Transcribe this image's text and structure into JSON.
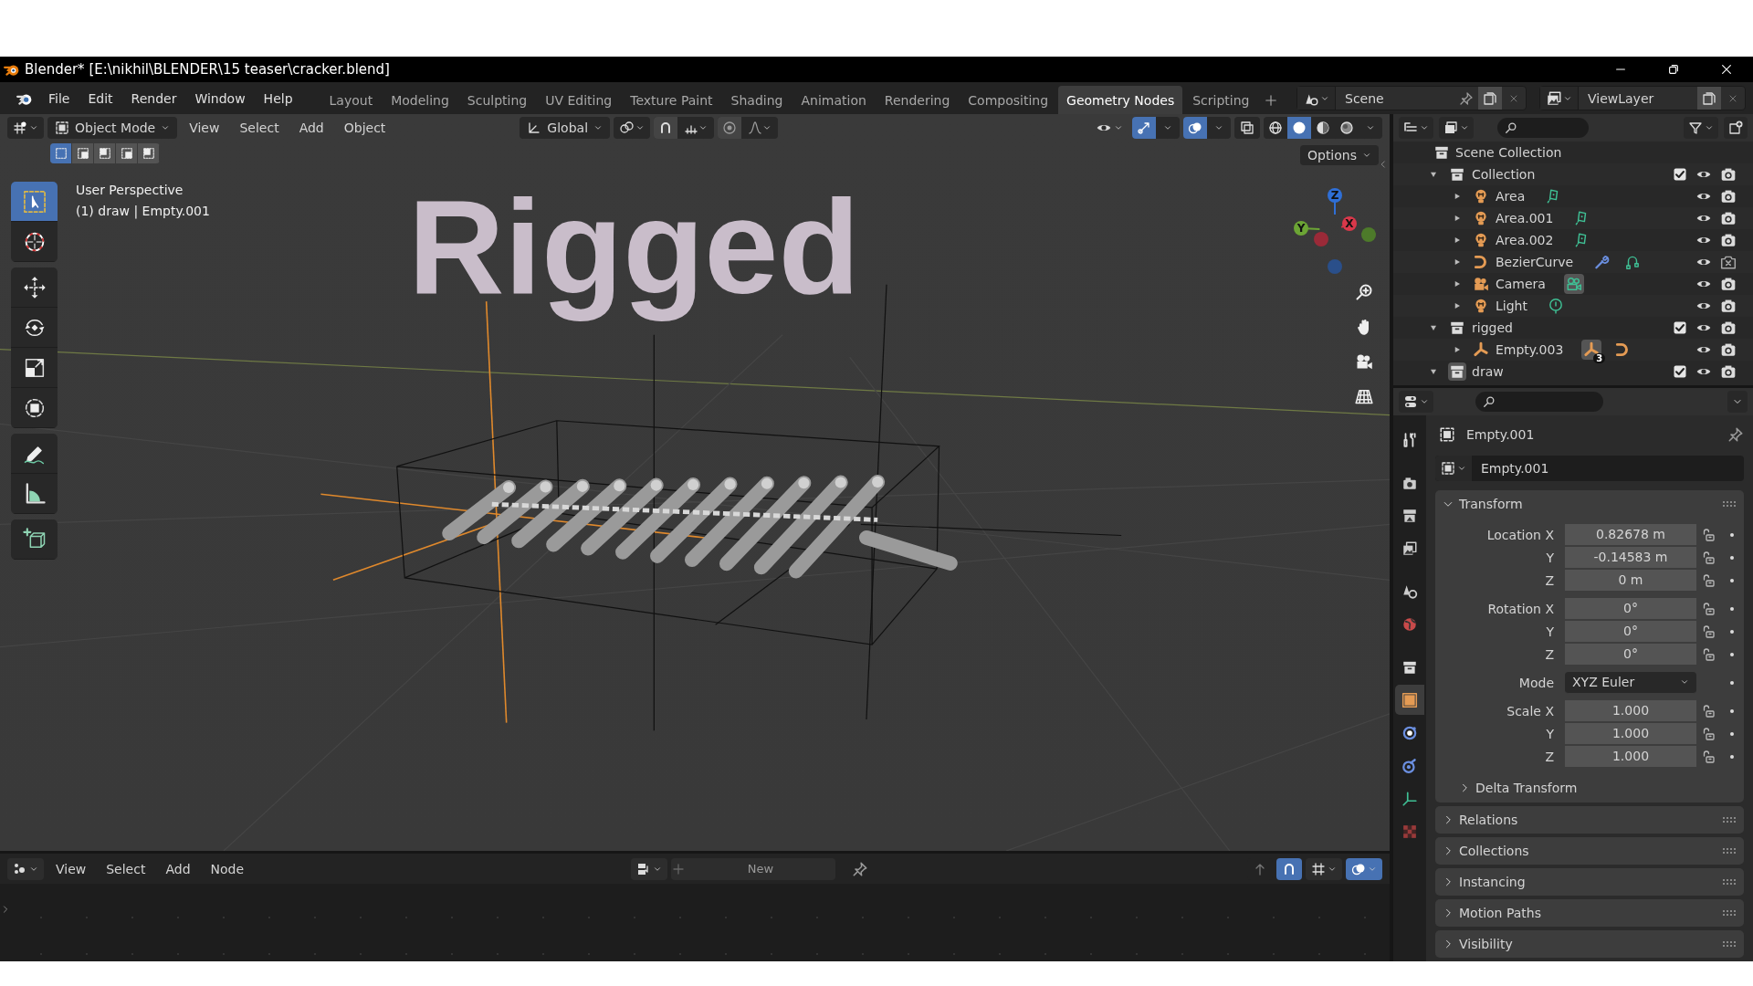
{
  "window": {
    "title": "Blender* [E:\\nikhil\\BLENDER\\15 teaser\\cracker.blend]"
  },
  "menu": [
    "File",
    "Edit",
    "Render",
    "Window",
    "Help"
  ],
  "workspaces": [
    {
      "label": "Layout",
      "selected": false
    },
    {
      "label": "Modeling",
      "selected": false
    },
    {
      "label": "Sculpting",
      "selected": false
    },
    {
      "label": "UV Editing",
      "selected": false
    },
    {
      "label": "Texture Paint",
      "selected": false
    },
    {
      "label": "Shading",
      "selected": false
    },
    {
      "label": "Animation",
      "selected": false
    },
    {
      "label": "Rendering",
      "selected": false
    },
    {
      "label": "Compositing",
      "selected": false
    },
    {
      "label": "Geometry Nodes",
      "selected": true
    },
    {
      "label": "Scripting",
      "selected": false
    }
  ],
  "scene": {
    "name": "Scene"
  },
  "view_layer": {
    "name": "ViewLayer"
  },
  "viewport": {
    "mode": "Object Mode",
    "menus": [
      "View",
      "Select",
      "Add",
      "Object"
    ],
    "orientation": "Global",
    "options_label": "Options",
    "select_modes": [
      {
        "selected": true
      },
      {
        "selected": false
      },
      {
        "selected": false
      },
      {
        "selected": false
      },
      {
        "selected": false
      }
    ],
    "gizmos_on": true,
    "overlays_on": true,
    "shading": [
      {
        "kind": "wireframe",
        "selected": false
      },
      {
        "kind": "solid",
        "selected": true
      },
      {
        "kind": "material",
        "selected": false
      },
      {
        "kind": "rendered",
        "selected": false
      }
    ],
    "tool_groups": [
      [
        {
          "kind": "select-box",
          "selected": true
        },
        {
          "kind": "cursor",
          "selected": false
        }
      ],
      [
        {
          "kind": "move",
          "selected": false
        },
        {
          "kind": "rotate",
          "selected": false
        },
        {
          "kind": "scale",
          "selected": false
        },
        {
          "kind": "transform",
          "selected": false
        }
      ],
      [
        {
          "kind": "annotate",
          "selected": false
        },
        {
          "kind": "measure",
          "selected": false
        }
      ],
      [
        {
          "kind": "add-cube",
          "selected": false
        }
      ]
    ],
    "info": [
      "User Perspective",
      "(1) draw | Empty.001"
    ],
    "text_object": "Rigged",
    "axes": [
      {
        "label": "Z"
      },
      {
        "label": "Y"
      },
      {
        "label": "X"
      }
    ]
  },
  "node_editor": {
    "menus": [
      "View",
      "Select",
      "Add",
      "Node"
    ],
    "new_label": "New",
    "snap_on": true,
    "overlays_on": true
  },
  "outliner": {
    "root": "Scene Collection",
    "items": [
      {
        "name": "Collection",
        "kind": "collection",
        "expanded": true,
        "checked": true,
        "active": false,
        "renderable": true,
        "children": [
          {
            "name": "Area",
            "kind": "light",
            "expanded": false,
            "renderable": true,
            "extras": [
              {
                "kind": "area-light",
                "active": false
              }
            ]
          },
          {
            "name": "Area.001",
            "kind": "light",
            "expanded": false,
            "renderable": true,
            "extras": [
              {
                "kind": "area-light",
                "active": false
              }
            ]
          },
          {
            "name": "Area.002",
            "kind": "light",
            "expanded": false,
            "renderable": true,
            "extras": [
              {
                "kind": "area-light",
                "active": false
              }
            ]
          },
          {
            "name": "BezierCurve",
            "kind": "curve",
            "expanded": false,
            "renderable": false,
            "extras": [
              {
                "kind": "modifier",
                "active": false
              },
              {
                "kind": "curve-data",
                "active": false
              }
            ]
          },
          {
            "name": "Camera",
            "kind": "camera",
            "expanded": false,
            "renderable": true,
            "extras": [
              {
                "kind": "camera-data",
                "active": true
              }
            ]
          },
          {
            "name": "Light",
            "kind": "light",
            "expanded": false,
            "renderable": true,
            "extras": [
              {
                "kind": "point-light",
                "active": false
              }
            ]
          }
        ]
      },
      {
        "name": "rigged",
        "kind": "collection",
        "expanded": true,
        "checked": true,
        "active": false,
        "renderable": true,
        "children": [
          {
            "name": "Empty.003",
            "kind": "empty",
            "expanded": false,
            "renderable": true,
            "extras": [
              {
                "kind": "empty",
                "active": true,
                "count": "3"
              },
              {
                "kind": "curve",
                "active": false
              }
            ]
          }
        ]
      },
      {
        "name": "draw",
        "kind": "collection",
        "expanded": true,
        "checked": true,
        "active": true,
        "renderable": true
      }
    ]
  },
  "properties": {
    "tabs": [
      {
        "kind": "tool",
        "selected": false
      },
      {
        "kind": "render",
        "selected": false
      },
      {
        "kind": "output",
        "selected": false
      },
      {
        "kind": "view-layer",
        "selected": false
      },
      {
        "kind": "scene",
        "selected": false
      },
      {
        "kind": "world",
        "selected": false
      },
      {
        "kind": "collection",
        "selected": false
      },
      {
        "kind": "object",
        "selected": true
      },
      {
        "kind": "physics",
        "selected": false
      },
      {
        "kind": "constraints",
        "selected": false
      },
      {
        "kind": "data",
        "selected": false
      },
      {
        "kind": "texture",
        "selected": false
      }
    ],
    "context_name": "Empty.001",
    "datablock_name": "Empty.001",
    "transform": {
      "title": "Transform",
      "expanded": true,
      "groups": [
        [
          {
            "label": "Location X",
            "value": "0.82678 m",
            "kind": "number"
          },
          {
            "label": "Y",
            "value": "-0.14583 m",
            "kind": "number"
          },
          {
            "label": "Z",
            "value": "0 m",
            "kind": "number"
          }
        ],
        [
          {
            "label": "Rotation X",
            "value": "0°",
            "kind": "number"
          },
          {
            "label": "Y",
            "value": "0°",
            "kind": "number"
          },
          {
            "label": "Z",
            "value": "0°",
            "kind": "number"
          }
        ],
        [
          {
            "label": "Mode",
            "value": "XYZ Euler",
            "kind": "dropdown"
          }
        ],
        [
          {
            "label": "Scale X",
            "value": "1.000",
            "kind": "number"
          },
          {
            "label": "Y",
            "value": "1.000",
            "kind": "number"
          },
          {
            "label": "Z",
            "value": "1.000",
            "kind": "number"
          }
        ]
      ],
      "subpanels": [
        {
          "title": "Delta Transform",
          "expanded": false
        }
      ]
    },
    "panels": [
      {
        "title": "Relations",
        "expanded": false
      },
      {
        "title": "Collections",
        "expanded": false
      },
      {
        "title": "Instancing",
        "expanded": false
      },
      {
        "title": "Motion Paths",
        "expanded": false
      },
      {
        "title": "Visibility",
        "expanded": false
      }
    ]
  }
}
